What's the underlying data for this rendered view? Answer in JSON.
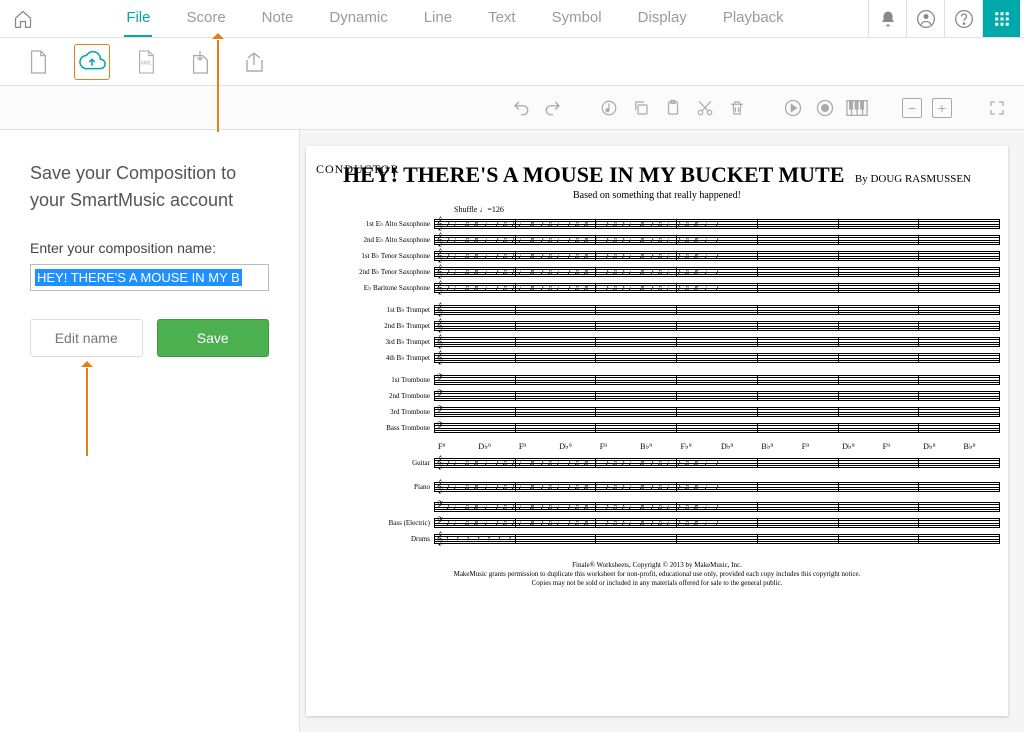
{
  "menubar": {
    "items": [
      "File",
      "Score",
      "Note",
      "Dynamic",
      "Line",
      "Text",
      "Symbol",
      "Display",
      "Playback"
    ],
    "active_index": 0
  },
  "file_toolbar": {
    "icons": [
      "new-file-icon",
      "cloud-upload-icon",
      "xml-icon",
      "import-icon",
      "export-icon"
    ],
    "active_index": 1
  },
  "action_toolbar": {
    "groups": [
      [
        "undo-icon",
        "redo-icon"
      ],
      [
        "note-tool-icon",
        "copy-icon",
        "paste-icon",
        "cut-icon",
        "delete-icon"
      ],
      [
        "play-icon",
        "record-icon",
        "piano-icon"
      ],
      [
        "zoom-out-icon",
        "zoom-in-icon"
      ],
      [
        "fullscreen-icon"
      ]
    ]
  },
  "sidebar": {
    "heading": "Save your Composition to your SmartMusic account",
    "label": "Enter your composition name:",
    "composition_name": "HEY! THERE'S A MOUSE IN MY B",
    "edit_button": "Edit name",
    "save_button": "Save"
  },
  "score": {
    "part_label": "CONDUCTOR",
    "title": "HEY! THERE'S A MOUSE IN MY BUCKET MUTE",
    "byline": "By DOUG RASMUSSEN",
    "subtitle": "Based on something that really happened!",
    "tempo": "Shuffle ♩=126",
    "instrument_groups": [
      {
        "name": "saxes",
        "instruments": [
          "1st E♭ Alto Saxophone",
          "2nd E♭ Alto Saxophone",
          "1st B♭ Tenor Saxophone",
          "2nd B♭ Tenor Saxophone",
          "E♭ Baritone Saxophone"
        ],
        "clef": "𝄞"
      },
      {
        "name": "trumpets",
        "instruments": [
          "1st B♭ Trumpet",
          "2nd B♭ Trumpet",
          "3rd B♭ Trumpet",
          "4th B♭ Trumpet"
        ],
        "clef": "𝄞"
      },
      {
        "name": "trombones",
        "instruments": [
          "1st Trombone",
          "2nd Trombone",
          "3rd Trombone",
          "Bass Trombone"
        ],
        "clef": "𝄢"
      },
      {
        "name": "rhythm",
        "instruments": [
          "Guitar",
          "Piano",
          "Bass (Electric)",
          "Drums"
        ],
        "clef": "𝄞"
      }
    ],
    "measures_per_system": 7,
    "chord_row": [
      "F⁹",
      "D♭⁹",
      "F⁹",
      "D♭⁹",
      "F⁹",
      "B♭⁹",
      "F♭⁹",
      "D♭⁹",
      "B♭⁹",
      "F⁹",
      "D♭⁹",
      "F⁹",
      "D♭⁹",
      "B♭⁹"
    ],
    "footer": [
      "Finale® Worksheets, Copyright © 2013 by MakeMusic, Inc.",
      "MakeMusic grants permission to duplicate this worksheet for non-profit, educational use only, provided each copy includes this copyright notice.",
      "Copies may not be sold or included in any materials offered for sale to the general public."
    ]
  }
}
